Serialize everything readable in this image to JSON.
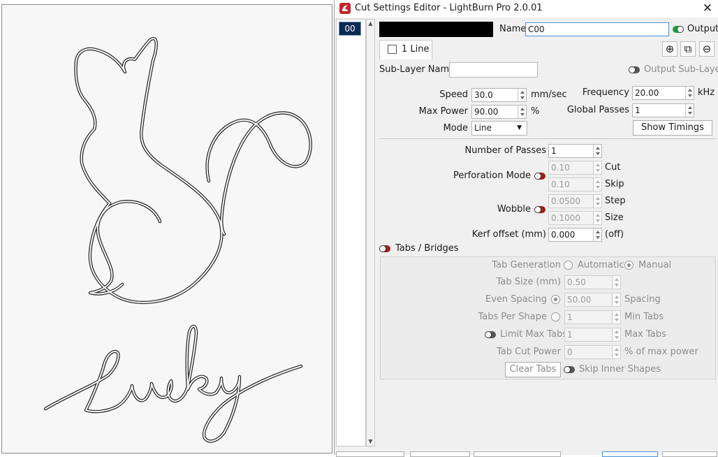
{
  "window": {
    "title": "Cut Settings Editor - LightBurn Pro 2.0.01",
    "close_glyph": "✕",
    "app_icon": "lightburn-logo-icon"
  },
  "layer_list": {
    "items": [
      {
        "label": "00"
      }
    ]
  },
  "header": {
    "color": "#000000",
    "name_label": "Name",
    "name_value": "C00",
    "output_label": "Output",
    "output_on": true
  },
  "sublayer_tab": {
    "label": "1 Line",
    "checked": false
  },
  "sublayer_actions": {
    "add_glyph": "⊕",
    "copy_glyph": "⧉",
    "remove_glyph": "⊖"
  },
  "sublayer": {
    "name_label": "Sub-Layer Name",
    "name_value": "",
    "output_label": "Output Sub-Layer"
  },
  "settings": {
    "speed_label": "Speed",
    "speed_value": "30.0",
    "speed_unit": "mm/sec",
    "max_power_label": "Max Power",
    "max_power_value": "90.00",
    "max_power_unit": "%",
    "mode_label": "Mode",
    "mode_value": "Line",
    "frequency_label": "Frequency",
    "frequency_value": "20.00",
    "frequency_unit": "kHz",
    "global_passes_label": "Global Passes",
    "global_passes_value": "1",
    "show_timings_label": "Show Timings"
  },
  "advanced": {
    "passes_label": "Number of Passes",
    "passes_value": "1",
    "perforation_label": "Perforation Mode",
    "perf_cut_value": "0.10",
    "perf_cut_unit": "Cut",
    "perf_skip_value": "0.10",
    "perf_skip_unit": "Skip",
    "wobble_label": "Wobble",
    "wobble_step_value": "0.0500",
    "wobble_step_unit": "Step",
    "wobble_size_value": "0.1000",
    "wobble_size_unit": "Size",
    "kerf_label": "Kerf offset (mm)",
    "kerf_value": "0.000",
    "kerf_unit": "(off)"
  },
  "tabs_bridges": {
    "label": "Tabs / Bridges",
    "generation_label": "Tab Generation",
    "automatic_label": "Automatic",
    "manual_label": "Manual",
    "size_label": "Tab Size (mm)",
    "size_value": "0.50",
    "even_spacing_label": "Even Spacing",
    "even_spacing_value": "50.00",
    "spacing_unit": "Spacing",
    "per_shape_label": "Tabs Per Shape",
    "per_shape_value": "1",
    "min_tabs_unit": "Min Tabs",
    "limit_max_label": "Limit Max Tabs",
    "max_tabs_value": "1",
    "max_tabs_unit": "Max Tabs",
    "cut_power_label": "Tab Cut Power",
    "cut_power_value": "0",
    "cut_power_unit": "% of max power",
    "clear_tabs_label": "Clear Tabs",
    "skip_inner_label": "Skip Inner Shapes"
  }
}
